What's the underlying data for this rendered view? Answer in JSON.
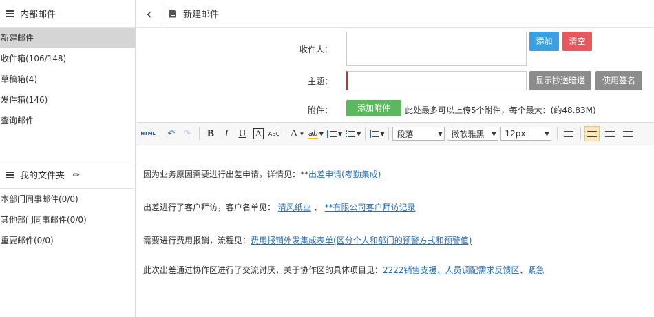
{
  "sidebar": {
    "header": "内部邮件",
    "items": [
      {
        "label": "新建邮件",
        "active": true
      },
      {
        "label": "收件箱(106/148)",
        "active": false
      },
      {
        "label": "草稿箱(4)",
        "active": false
      },
      {
        "label": "发件箱(146)",
        "active": false
      },
      {
        "label": "查询邮件",
        "active": false
      }
    ],
    "folders_header": "我的文件夹",
    "folders": [
      {
        "label": "本部门同事邮件(0/0)"
      },
      {
        "label": "其他部门同事邮件(0/0)"
      },
      {
        "label": "重要邮件(0/0)"
      }
    ]
  },
  "header": {
    "back_icon": "‹",
    "title": "新建邮件"
  },
  "form": {
    "recipient_label": "收件人：",
    "add_button": "添加",
    "clear_button": "清空",
    "subject_label": "主题：",
    "subject_value": "",
    "cc_button": "显示抄送暗送",
    "signature_button": "使用签名",
    "attachment_label": "附件：",
    "add_attachment_button": "添加附件",
    "attachment_note": "此处最多可以上传5个附件，每个最大：(约48.83M)"
  },
  "toolbar": {
    "html": "HTML",
    "undo": "↶",
    "redo": "↷",
    "bold": "B",
    "italic": "I",
    "underline": "U",
    "border_a": "A",
    "strike": "ABC",
    "font_color": "A",
    "highlight": "ab",
    "paragraph_select": "段落",
    "font_select": "微软雅黑",
    "size_select": "12px"
  },
  "body": {
    "p1_text": "因为业务原因需要进行出差申请，详情见：**",
    "p1_link": "出差申请(考勤集成)",
    "p2_text": "出差进行了客户拜访，客户名单见：",
    "p2_link1": "清风纸业",
    "p2_sep": "、",
    "p2_link2": "**有限公司客户拜访记录",
    "p3_text": "需要进行费用报销，流程见：",
    "p3_link": "费用报销外发集成表单(区分个人和部门的预警方式和预警值)",
    "p4_text": "此次出差通过协作区进行了交流讨厌，关于协作区的具体项目见：",
    "p4_link1": "2222销售支援、人员调配需求反馈区",
    "p4_sep": "、",
    "p4_link2": "紧急"
  },
  "colors": {
    "blue_button": "#3c9fe0",
    "red_button": "#e4585e",
    "gray_button": "#8c8c8c",
    "green_button": "#5cb85c",
    "link": "#2a6db5",
    "active_item": "#d5d5d5"
  }
}
